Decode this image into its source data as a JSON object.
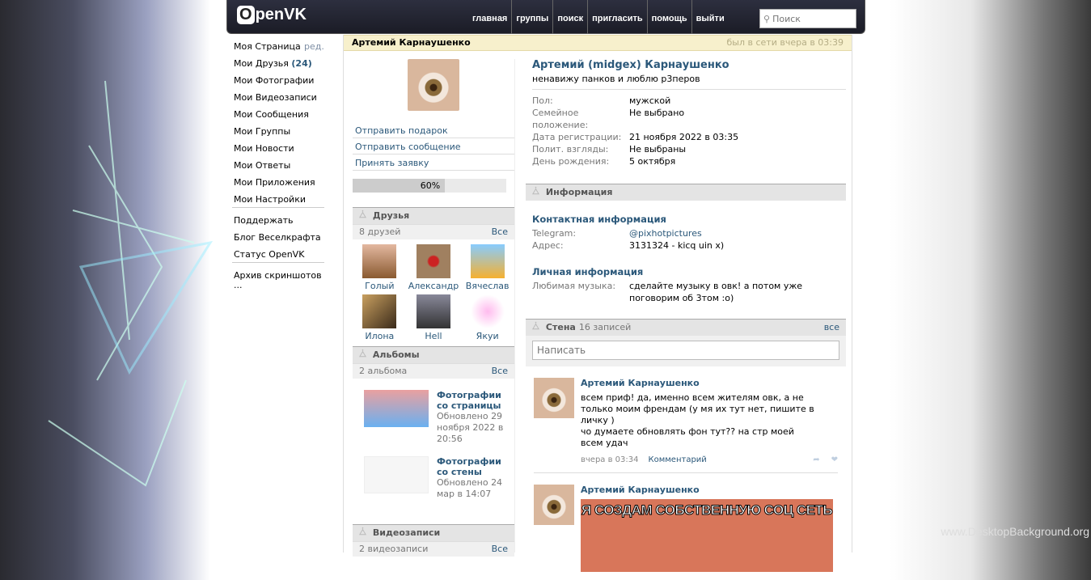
{
  "header": {
    "logo": "OpenVK",
    "nav": [
      "главная",
      "группы",
      "поиск",
      "пригласить",
      "помощь",
      "выйти"
    ],
    "search_placeholder": "Поиск"
  },
  "menu": {
    "items": [
      "Моя Страница",
      "Мои Друзья",
      "Мои Фотографии",
      "Мои Видеозаписи",
      "Мои Сообщения",
      "Мои Группы",
      "Мои Новости",
      "Мои Ответы",
      "Мои Приложения",
      "Мои Настройки"
    ],
    "edit": "ред.",
    "friends_count": "(24)",
    "extra": [
      "Поддержать",
      "Блог Веселкрафта",
      "Статус OpenVK"
    ],
    "archive": "Архив скриншотов ..."
  },
  "profile": {
    "name": "Артемий Карнаушенко",
    "last_seen": "был в сети вчера в 03:39",
    "full_name": "Артемий (midgex) Карнаушенко",
    "status": "ненавижу панков и люблю р3перов",
    "fields": [
      {
        "k": "Пол:",
        "v": "мужской"
      },
      {
        "k": "Семейное положение:",
        "v": "Не выбрано"
      },
      {
        "k": "Дата регистрации:",
        "v": "21 ноября 2022 в 03:35"
      },
      {
        "k": "Полит. взгляды:",
        "v": "Не выбраны"
      },
      {
        "k": "День рождения:",
        "v": "5 октября"
      }
    ],
    "actions": [
      "Отправить подарок",
      "Отправить сообщение",
      "Принять заявку"
    ],
    "completeness": "60%",
    "completeness_value": 60
  },
  "friends": {
    "title": "Друзья",
    "count": "8 друзей",
    "all": "Все",
    "list": [
      "Голый",
      "Александр",
      "Вячеслав",
      "Илона",
      "Hell",
      "Якуи"
    ]
  },
  "albums": {
    "title": "Альбомы",
    "count": "2 альбома",
    "all": "Все",
    "list": [
      {
        "name": "Фотографии со страницы",
        "date": "Обновлено 29 ноября 2022 в 20:56"
      },
      {
        "name": "Фотографии со стены",
        "date": "Обновлено 24 мар в 14:07"
      }
    ]
  },
  "videos": {
    "title": "Видеозаписи",
    "count": "2 видеозаписи",
    "all": "Все"
  },
  "info": {
    "title": "Информация",
    "contact_title": "Контактная информация",
    "contact": [
      {
        "k": "Telegram:",
        "v": "@pixhotpictures"
      },
      {
        "k": "Адрес:",
        "v": "3131324 - kicq uin x)"
      }
    ],
    "personal_title": "Личная информация",
    "personal": [
      {
        "k": "Любимая музыка:",
        "v": "сделайте музыку в овк! а потом уже поговорим об 3том :o)"
      }
    ]
  },
  "wall": {
    "title": "Стена",
    "count": "16 записей",
    "all": "все",
    "placeholder": "Написать",
    "posts": [
      {
        "author": "Артемий Карнаушенко",
        "lines": [
          "всем приф! да, именно всем жителям овк, а не только моим френдам (у мя их тут нет, пишите в личку )",
          "чо думаете обновлять фон тут?? на стр моей",
          "всем удач"
        ],
        "time": "вчера в 03:34",
        "comment": "Комментарий"
      },
      {
        "author": "Артемий Карнаушенко",
        "meme": "Я СОЗДАМ СОБСТВЕННУЮ СОЦ СЕТЬ"
      }
    ]
  },
  "watermark": "www.DesktopBackground.org"
}
